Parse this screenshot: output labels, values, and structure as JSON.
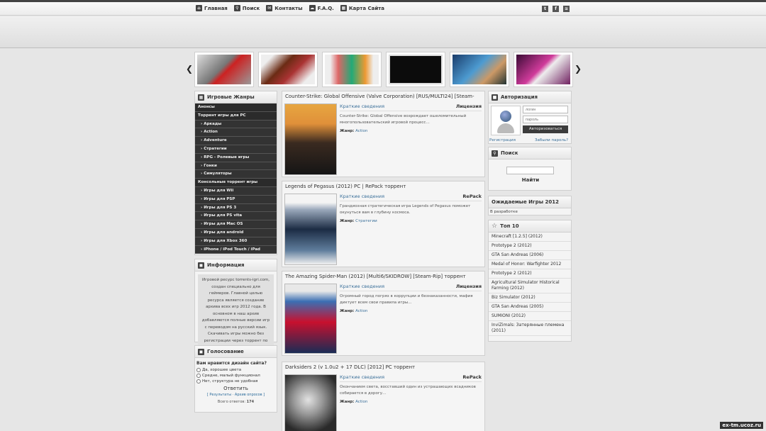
{
  "nav": {
    "items": [
      {
        "label": "Главная",
        "icon": "home-icon"
      },
      {
        "label": "Поиск",
        "icon": "search-icon"
      },
      {
        "label": "Контакты",
        "icon": "mail-icon"
      },
      {
        "label": "F.A.Q.",
        "icon": "chat-icon"
      },
      {
        "label": "Карта Сайта",
        "icon": "sitemap-icon"
      }
    ],
    "social": [
      "twitter-icon",
      "facebook-icon",
      "rss-icon"
    ]
  },
  "genres": {
    "title": "Игровые Жанры",
    "items": [
      {
        "label": "Анонсы",
        "level": "top"
      },
      {
        "label": "Торрент игры для PC",
        "level": "top"
      },
      {
        "label": "Аркады",
        "level": "sub"
      },
      {
        "label": "Action",
        "level": "sub"
      },
      {
        "label": "Adventure",
        "level": "sub"
      },
      {
        "label": "Стратегии",
        "level": "sub"
      },
      {
        "label": "RPG - Ролевые игры",
        "level": "sub"
      },
      {
        "label": "Гонки",
        "level": "sub"
      },
      {
        "label": "Симуляторы",
        "level": "sub"
      },
      {
        "label": "Консольные торрент игры",
        "level": "top"
      },
      {
        "label": "Игры для Wii",
        "level": "sub"
      },
      {
        "label": "Игры для PSP",
        "level": "sub"
      },
      {
        "label": "Игры для PS 3",
        "level": "sub"
      },
      {
        "label": "Игры для PS vita",
        "level": "sub"
      },
      {
        "label": "Игры для Mac OS",
        "level": "sub"
      },
      {
        "label": "Игры для android",
        "level": "sub"
      },
      {
        "label": "Игры для Xbox 360",
        "level": "sub"
      },
      {
        "label": "iPhone / iPod Touch / iPad",
        "level": "sub"
      }
    ]
  },
  "info": {
    "title": "Информация",
    "text": "Игровой ресурс torrents-igri.com, создан специально для геймеров. Главной целью ресурса является создание архива всех игр 2012 года. В основном в наш архив добавляются полные версии игр с переводом на русский язык. Скачивать игры можно без регистрации через торрент по прямой ссылке бесплатно."
  },
  "poll": {
    "title": "Голосование",
    "question": "Вам нравится дизайн сайта?",
    "options": [
      "Да, хорошее цвета",
      "Средне, малый функционал",
      "Нет, структура не удобная"
    ],
    "vote_label": "Ответить",
    "results_label": "Результаты",
    "archive_label": "Архив опросов",
    "total_label": "Всего ответов:",
    "total_value": "174"
  },
  "news": [
    {
      "title": "Counter-Strike: Global Offensive (Valve Corporation) [RUS/MULTI24] [Steam-",
      "short_label": "Краткие сведения",
      "kind": "Лицензия",
      "desc": "Counter-Strike: Global Offensive возрождает ошеломительный многопользовательский игровой процесс...",
      "genre_label": "Жанр:",
      "genre": "Action"
    },
    {
      "title": "Legends of Pegasus (2012) PC | RePack торрент",
      "short_label": "Краткие сведения",
      "kind": "RePack",
      "desc": "Грандиозная стратегическая игра Legends of Pegasus поможет окунуться вам в глубину космоса.",
      "genre_label": "Жанр:",
      "genre": "Стратегии"
    },
    {
      "title": "The Amazing Spider-Man (2012) [Multi6/SKIDROW] [Steam-Rip] торрент",
      "short_label": "Краткие сведения",
      "kind": "Лицензия",
      "desc": "Огромный город погряз в коррупции и безнаказанности, мафия диктует всем свои правила игры...",
      "genre_label": "Жанр:",
      "genre": "Action"
    },
    {
      "title": "Darksiders 2 (v 1.0u2 + 17 DLC) [2012] PC торрент",
      "short_label": "Краткие сведения",
      "kind": "RePack",
      "desc": "Окончанием света, восставший один из устрашающих всадников собирается в дорогу...",
      "genre_label": "Жанр:",
      "genre": "Action"
    }
  ],
  "auth": {
    "title": "Авторизация",
    "login_placeholder": "логин",
    "password_placeholder": "пароль",
    "submit_label": "Авторизоваться",
    "register_label": "Регистрация",
    "forgot_label": "Забыли пароль?"
  },
  "search": {
    "title": "Поиск",
    "button_label": "Найти"
  },
  "expected": {
    "title": "Ожидаемые Игры 2012",
    "text": "В разработке"
  },
  "top10": {
    "title": "Топ 10",
    "items": [
      "Minecraft [1.2.5] (2012)",
      "Prototype 2 (2012)",
      "GTA San Andreas (2006)",
      "Medal of Honor: Warfighter 2012",
      "Prototype 2 (2012)",
      "Agricultural Simulator Historical Farming (2012)",
      "Biz Simulator (2012)",
      "GTA San Andreas (2005)",
      "SUMIONI (2012)",
      "InviZimals: Затерянные племена (2011)"
    ]
  },
  "watermark": "ex-tm.ucoz.ru",
  "colors": {
    "accent": "#3a6f99",
    "dark_menu": "#333333"
  }
}
